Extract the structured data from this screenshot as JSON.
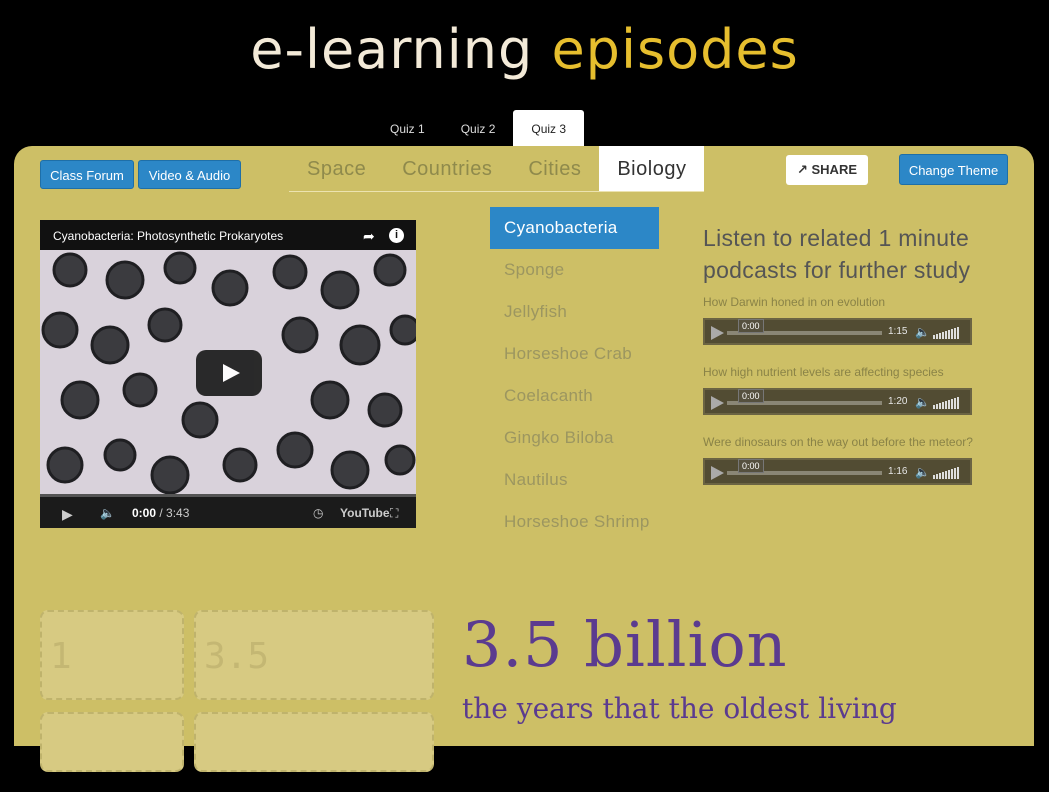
{
  "logo": {
    "part1": "e-learning",
    "part2": "episodes"
  },
  "quiz_tabs": [
    "Quiz 1",
    "Quiz 2",
    "Quiz 3"
  ],
  "buttons": {
    "class_forum": "Class Forum",
    "video_audio": "Video & Audio",
    "share": "SHARE",
    "change_theme": "Change Theme"
  },
  "topic_tabs": [
    "Space",
    "Countries",
    "Cities",
    "Biology"
  ],
  "active_topic": "Biology",
  "video": {
    "title": "Cyanobacteria: Photosynthetic Prokaryotes",
    "current_time": "0:00",
    "duration": "/ 3:43",
    "brand": "YouTube"
  },
  "species": [
    "Cyanobacteria",
    "Sponge",
    "Jellyfish",
    "Horseshoe Crab",
    "Coelacanth",
    "Gingko Biloba",
    "Nautilus",
    "Horseshoe Shrimp"
  ],
  "podcasts": {
    "heading_line1": "Listen to related 1 minute",
    "heading_line2": "podcasts for further study",
    "items": [
      {
        "title": "How Darwin honed in on evolution",
        "current": "0:00",
        "duration": "1:15"
      },
      {
        "title": "How high nutrient levels are affecting species",
        "current": "0:00",
        "duration": "1:20"
      },
      {
        "title": "Were dinosaurs on the way out before the meteor?",
        "current": "0:00",
        "duration": "1:16"
      }
    ]
  },
  "cards": [
    "1",
    "3.5 billion"
  ],
  "stat": {
    "value": "3.5 billion",
    "description": "the years that the oldest living"
  },
  "colors": {
    "accent": "#2c87c7",
    "panel": "#cdbf66",
    "stat": "#5b3b8f",
    "logo_gold": "#e6be2e"
  }
}
